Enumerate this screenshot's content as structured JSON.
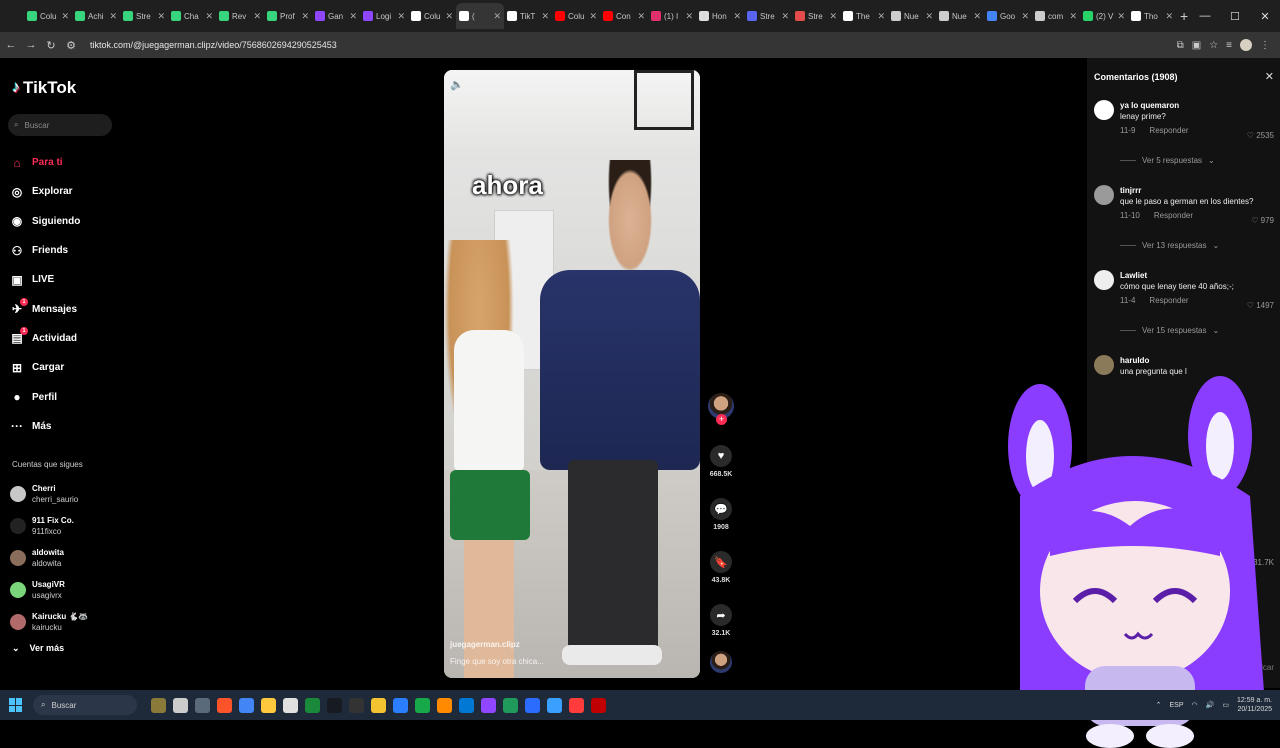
{
  "browser": {
    "tabs": [
      {
        "label": "Colu",
        "color": "#37d67a"
      },
      {
        "label": "Achi",
        "color": "#37d67a"
      },
      {
        "label": "Stre",
        "color": "#37d67a"
      },
      {
        "label": "Cha",
        "color": "#37d67a"
      },
      {
        "label": "Rev",
        "color": "#37d67a"
      },
      {
        "label": "Prof",
        "color": "#37d67a"
      },
      {
        "label": "Gan",
        "color": "#9146ff"
      },
      {
        "label": "Logi",
        "color": "#9146ff"
      },
      {
        "label": "Colu",
        "color": "#ffffff"
      },
      {
        "label": "(",
        "color": "#ffffff",
        "active": true
      },
      {
        "label": "TikT",
        "color": "#ffffff"
      },
      {
        "label": "Colu",
        "color": "#ff0000"
      },
      {
        "label": "Con",
        "color": "#ff0000"
      },
      {
        "label": "(1) I",
        "color": "#e1306c"
      },
      {
        "label": "Hon",
        "color": "#dddddd"
      },
      {
        "label": "Stre",
        "color": "#5865f2"
      },
      {
        "label": "Stre",
        "color": "#e64b4b"
      },
      {
        "label": "The",
        "color": "#ffffff"
      },
      {
        "label": "Nue",
        "color": "#cccccc"
      },
      {
        "label": "Nue",
        "color": "#cccccc"
      },
      {
        "label": "Goo",
        "color": "#4285f4"
      },
      {
        "label": "com",
        "color": "#cccccc"
      },
      {
        "label": "(2) V",
        "color": "#25d366"
      },
      {
        "label": "Tho",
        "color": "#ffffff"
      }
    ],
    "url": "tiktok.com/@juegagerman.clipz/video/7568602694290525453"
  },
  "sidebar": {
    "logo": "TikTok",
    "search_placeholder": "Buscar",
    "nav": [
      {
        "label": "Para ti",
        "icon": "home-icon",
        "glyph": "⌂",
        "active": true
      },
      {
        "label": "Explorar",
        "icon": "compass-icon",
        "glyph": "◎"
      },
      {
        "label": "Siguiendo",
        "icon": "following-icon",
        "glyph": "◉"
      },
      {
        "label": "Friends",
        "icon": "friends-icon",
        "glyph": "⚇"
      },
      {
        "label": "LIVE",
        "icon": "live-icon",
        "glyph": "▣"
      },
      {
        "label": "Mensajes",
        "icon": "messages-icon",
        "glyph": "✈",
        "badge": "1"
      },
      {
        "label": "Actividad",
        "icon": "activity-icon",
        "glyph": "▤",
        "badge": "1"
      },
      {
        "label": "Cargar",
        "icon": "upload-icon",
        "glyph": "⊞"
      },
      {
        "label": "Perfil",
        "icon": "profile-icon",
        "glyph": "●"
      },
      {
        "label": "Más",
        "icon": "more-icon",
        "glyph": "···"
      }
    ],
    "following_title": "Cuentas que sigues",
    "following": [
      {
        "name": "Cherri",
        "user": "cherri_saurio",
        "color": "#c8c8c8"
      },
      {
        "name": "911 Fix Co.",
        "user": "911fixco",
        "color": "#222222"
      },
      {
        "name": "aldowita",
        "user": "aldowita",
        "color": "#8a6d5a"
      },
      {
        "name": "UsagiVR",
        "user": "usagivrx",
        "color": "#7bd67b"
      },
      {
        "name": "Kairucku 🐇🦝",
        "user": "kairucku",
        "color": "#b06a6a"
      }
    ],
    "see_more": "Ver más"
  },
  "video": {
    "overlay_text": "ahora",
    "author": "juegagerman.clipz",
    "description": "Finge que soy otra chica..."
  },
  "actions": {
    "likes": "668.5K",
    "comments": "1908",
    "saves": "43.8K",
    "shares": "32.1K"
  },
  "comments": {
    "header": "Comentarios (1908)",
    "items": [
      {
        "user": "ya lo quemaron",
        "text": "lenay prime?",
        "date": "11-9",
        "reply": "Responder",
        "likes": "2535",
        "replies": "Ver 5 respuestas",
        "color": "#ffffff"
      },
      {
        "user": "tinjrrr",
        "text": "que le paso a german en los dientes?",
        "date": "11-10",
        "reply": "Responder",
        "likes": "979",
        "replies": "Ver 13 respuestas",
        "color": "#9a9a9a"
      },
      {
        "user": "Lawliet",
        "text": "cómo que lenay tiene 40 años;-;",
        "date": "11-4",
        "reply": "Responder",
        "likes": "1497",
        "replies": "Ver 15 respuestas",
        "color": "#eeeeee"
      },
      {
        "user": "haruldo",
        "text": "una pregunta que l",
        "color": "#8a7a5a"
      }
    ],
    "side_like": "31.7K",
    "publish": "Publicar"
  },
  "taskbar": {
    "search": "Buscar",
    "lang": "ESP",
    "time": "12:59 a. m.",
    "date": "20/11/2025",
    "icons": [
      "#8a7a3a",
      "#cccccc",
      "#5a6a7a",
      "#fb542b",
      "#4285f4",
      "#ffc83d",
      "#e0e0e0",
      "#1a8a3a",
      "#171a21",
      "#333333",
      "#f4c430",
      "#2b7fff",
      "#17a84a",
      "#ff8a00",
      "#0078d4",
      "#9146ff",
      "#1f9a5a",
      "#2b6cff",
      "#3aa0ff",
      "#ff3b3b",
      "#c00000"
    ]
  }
}
